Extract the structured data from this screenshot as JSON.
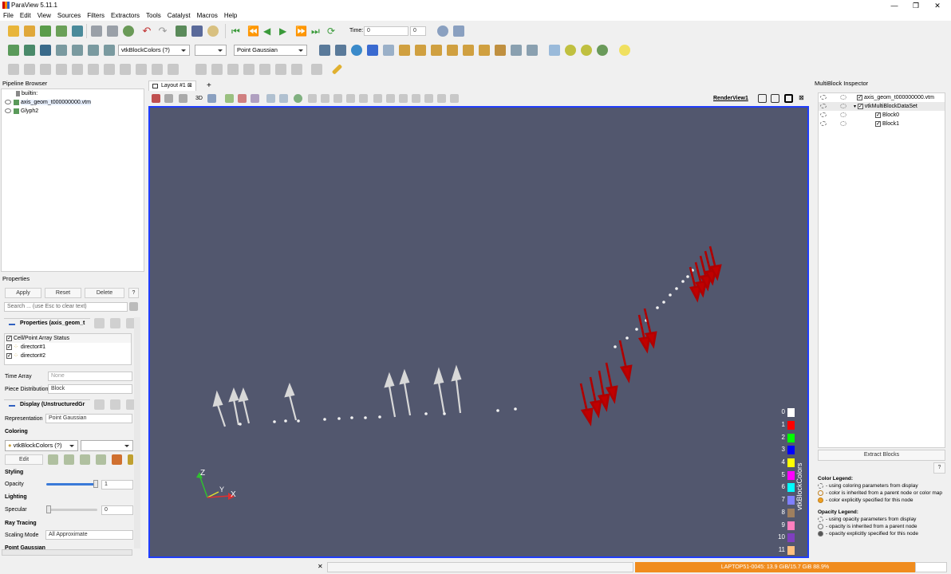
{
  "app": {
    "title": "ParaView 5.11.1",
    "min": "—",
    "max": "❐",
    "close": "✕"
  },
  "menu": [
    "File",
    "Edit",
    "View",
    "Sources",
    "Filters",
    "Extractors",
    "Tools",
    "Catalyst",
    "Macros",
    "Help"
  ],
  "toolbar": {
    "time_label": "Time:",
    "time_value": "0",
    "time_index": "0",
    "color_combo": "vtkBlockColors (?)",
    "rep_combo": "Point Gaussian"
  },
  "pipeline": {
    "title": "Pipeline Browser",
    "items": [
      "builtin:",
      "axis_geom_t000000000.vtm",
      "Glyph2"
    ]
  },
  "properties": {
    "title": "Properties",
    "apply": "Apply",
    "reset": "Reset",
    "delete": "Delete",
    "help": "?",
    "search_placeholder": "Search ... (use Esc to clear text)",
    "section": "Properties (axis_geom_t",
    "array_header": "Cell/Point Array Status",
    "arrays": [
      "director#1",
      "director#2"
    ],
    "time_array_label": "Time Array",
    "time_array_value": "None",
    "piece_label": "Piece Distribution",
    "piece_value": "Block",
    "display_section": "Display (UnstructuredGr",
    "rep_label": "Representation",
    "rep_value": "Point Gaussian",
    "coloring": "Coloring",
    "color_value": "vtkBlockColors (?)",
    "edit": "Edit",
    "styling": "Styling",
    "opacity_label": "Opacity",
    "opacity_value": "1",
    "lighting": "Lighting",
    "specular_label": "Specular",
    "specular_value": "0",
    "raytracing": "Ray Tracing",
    "scaling_label": "Scaling Mode",
    "scaling_value": "All Approximate",
    "point_gaussian": "Point Gaussian"
  },
  "layout": {
    "tab": "Layout #1",
    "add": "+",
    "view_name": "RenderView1",
    "view_3d": "3D"
  },
  "orientation": {
    "z": "Z",
    "y": "Y",
    "x": "X"
  },
  "legend": {
    "title": "vtkBlockColors",
    "entries": [
      {
        "label": "0",
        "color": "#ffffff"
      },
      {
        "label": "1",
        "color": "#ff0000"
      },
      {
        "label": "2",
        "color": "#00ff00"
      },
      {
        "label": "3",
        "color": "#0000ff"
      },
      {
        "label": "4",
        "color": "#ffff00"
      },
      {
        "label": "5",
        "color": "#ff00ff"
      },
      {
        "label": "6",
        "color": "#00ffff"
      },
      {
        "label": "7",
        "color": "#7f7fff"
      },
      {
        "label": "8",
        "color": "#9f7f5f"
      },
      {
        "label": "9",
        "color": "#ff7fbf"
      },
      {
        "label": "10",
        "color": "#7f3fbf"
      },
      {
        "label": "11",
        "color": "#ffbf7f"
      }
    ]
  },
  "multiblock": {
    "title": "MultiBlock Inspector",
    "tree": [
      "axis_geom_t000000000.vtm",
      "vtkMultiBlockDataSet",
      "Block0",
      "Block1"
    ],
    "extract": "Extract Blocks",
    "help": "?",
    "color_legend": "Color Legend:",
    "color_items": [
      "- using coloring parameters from display",
      "- color is inherited from a parent node or color map",
      "- color explicitly specified for this node"
    ],
    "opacity_legend": "Opacity Legend:",
    "opacity_items": [
      "- using opacity parameters from display",
      "- opacity is inherited from a parent node",
      "- opacity explicitly specified for this node"
    ]
  },
  "status": {
    "memory": "LAPTOP51-0045: 13.9 GiB/15.7 GiB 88.9%",
    "close": "✕"
  }
}
